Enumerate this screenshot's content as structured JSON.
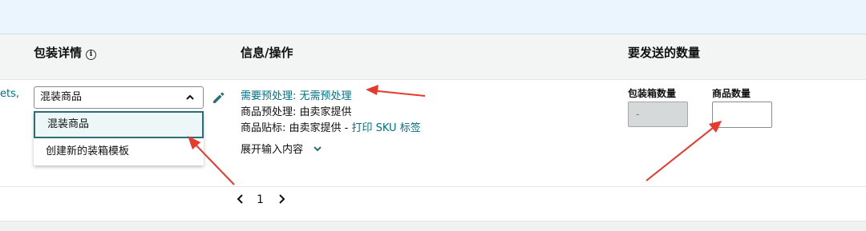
{
  "row_fragment": "ets,",
  "headers": {
    "packing_details": "包装详情",
    "info_actions": "信息/操作",
    "quantity_to_send": "要发送的数量"
  },
  "packing": {
    "selected_value": "混装商品",
    "options": [
      "混装商品",
      "创建新的装箱模板"
    ]
  },
  "info": {
    "prep_required_label": "需要预处理:",
    "prep_required_value": "无需预处理",
    "prep_label": "商品预处理:",
    "prep_value": "由卖家提供",
    "label_label": "商品贴标:",
    "label_value": "由卖家提供 -",
    "print_sku_link": "打印 SKU 标签",
    "expand_link": "展开输入内容"
  },
  "quantity": {
    "box_count_label": "包装箱数量",
    "box_count_value": "-",
    "item_count_label": "商品数量",
    "item_count_value": ""
  },
  "pagination": {
    "current_page": "1"
  },
  "colors": {
    "link": "#007185",
    "annotation_arrow": "#e8392c",
    "banner": "#eaf5fd"
  }
}
